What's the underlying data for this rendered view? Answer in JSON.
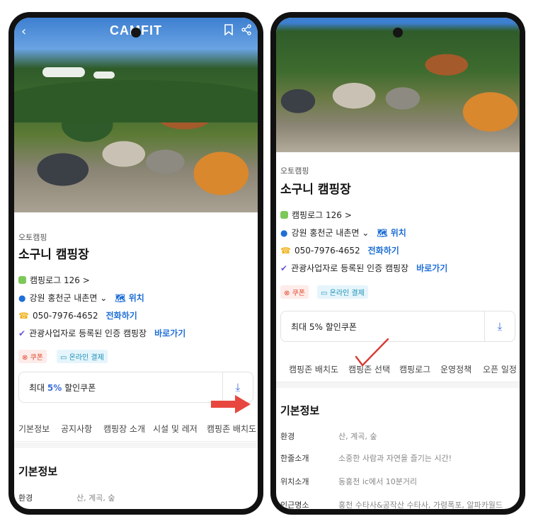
{
  "left": {
    "brand": "CAMFIT",
    "category": "오토캠핑",
    "name": "소구니 캠핑장",
    "camplog": "캠핑로그 126 >",
    "location": "강원 홍천군 내촌면 ⌄",
    "location_link": "위치",
    "phone": "050-7976-4652",
    "phone_link": "전화하기",
    "certified": "관광사업자로 등록된 인증 캠핑장",
    "certified_link": "바로가기",
    "badge_coupon": "쿠폰",
    "badge_pay": "온라인 결제",
    "coupon_prefix": "최대 ",
    "coupon_pct": "5%",
    "coupon_suffix": " 할인쿠폰",
    "tabs": [
      "기본정보",
      "공지사항",
      "캠핑장 소개",
      "시설 및 레저",
      "캠핑존 배치도"
    ],
    "section_title": "기본정보",
    "info": [
      {
        "k": "환경",
        "v": "산, 계곡, 숲"
      }
    ]
  },
  "right": {
    "category": "오토캠핑",
    "name": "소구니 캠핑장",
    "camplog": "캠핑로그 126 >",
    "location": "강원 홍천군 내촌면 ⌄",
    "location_link": "위치",
    "phone": "050-7976-4652",
    "phone_link": "전화하기",
    "certified": "관광사업자로 등록된 인증 캠핑장",
    "certified_link": "바로가기",
    "badge_coupon": "쿠폰",
    "badge_pay": "온라인 결제",
    "coupon_prefix": "최대 ",
    "coupon_pct": "5%",
    "coupon_suffix": " 할인쿠폰",
    "tabs": [
      "캠핑존 배치도",
      "캠핑존 선택",
      "캠핑로그",
      "운영정책",
      "오픈 일정"
    ],
    "section_title": "기본정보",
    "info": [
      {
        "k": "환경",
        "v": "산, 계곡, 숲"
      },
      {
        "k": "한줄소개",
        "v": "소중한 사람과 자연을 즐기는 시간!"
      },
      {
        "k": "위치소개",
        "v": "동홍천 ic에서 10분거리"
      },
      {
        "k": "인근명소",
        "v": "홍천 수타사&공작산 수타사, 가령폭포, 알파카월드"
      }
    ]
  },
  "colors": {
    "accent": "#1f6fd6",
    "coupon_red": "#e0492f",
    "arrow": "#e8473f",
    "check": "#d63a32"
  }
}
